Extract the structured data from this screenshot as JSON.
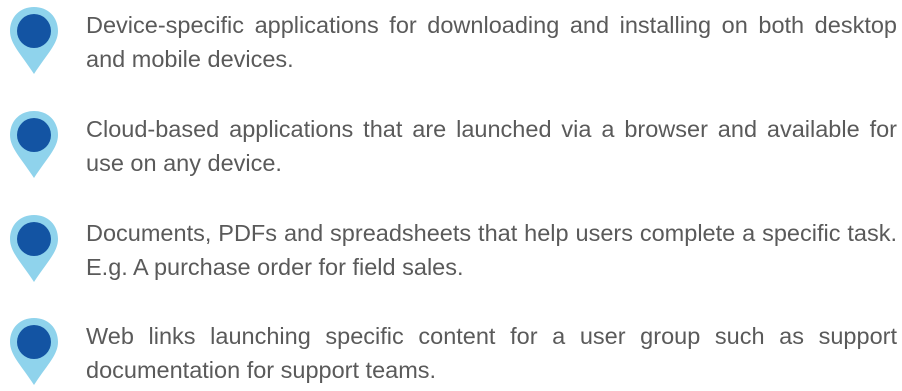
{
  "bullets": [
    {
      "icon": "location-pin-icon",
      "text": "Device-specific applications for downloading and installing on both desktop and mobile devices."
    },
    {
      "icon": "location-pin-icon",
      "text": "Cloud-based applications that are launched via a browser and available for use on any device."
    },
    {
      "icon": "location-pin-icon",
      "text": "Documents, PDFs and spreadsheets that help users complete a specific task. E.g. A purchase order for field sales."
    },
    {
      "icon": "location-pin-icon",
      "text": "Web links launching specific content for a user group such as support documentation for support teams."
    }
  ],
  "colors": {
    "pin_outer": "#8fd3ec",
    "pin_inner": "#1354a3",
    "text": "#5a5a5a"
  }
}
